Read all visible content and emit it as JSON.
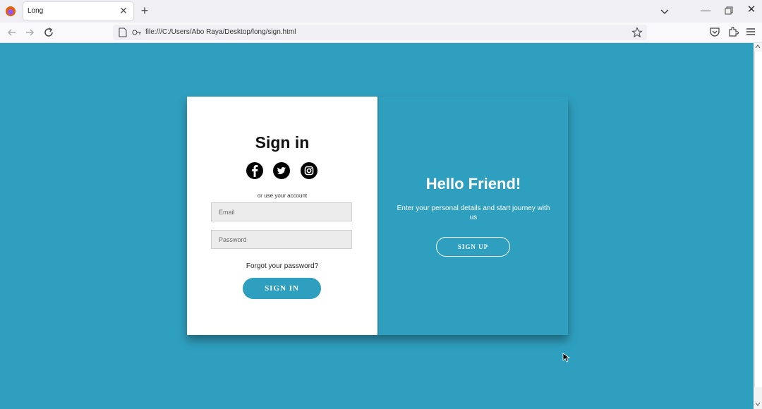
{
  "browser": {
    "tab_title": "Long",
    "url": "file:///C:/Users/Abo Raya/Desktop/long/sign.html",
    "accent": "#2f9fbf"
  },
  "signin": {
    "title": "Sign in",
    "social_icons": [
      "facebook-icon",
      "twitter-icon",
      "instagram-icon"
    ],
    "note": "or use your account",
    "email_placeholder": "Email",
    "password_placeholder": "Password",
    "forgot_label": "Forgot your password?",
    "button_label": "SIGN IN"
  },
  "signup": {
    "title": "Hello Friend!",
    "subtitle": "Enter your personal details and start journey with us",
    "button_label": "SIGN UP"
  }
}
